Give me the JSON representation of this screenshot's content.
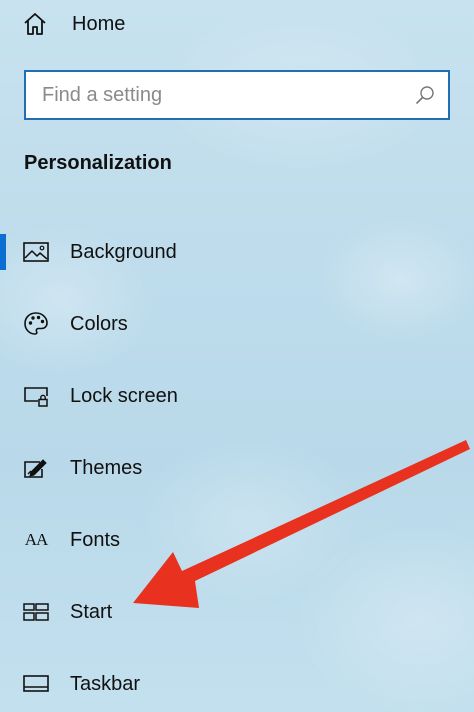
{
  "nav_home": {
    "label": "Home",
    "icon": "home-icon"
  },
  "search": {
    "placeholder": "Find a setting",
    "value": "",
    "icon": "search-icon"
  },
  "section": {
    "title": "Personalization"
  },
  "items": [
    {
      "label": "Background",
      "icon": "background-icon",
      "selected": true
    },
    {
      "label": "Colors",
      "icon": "palette-icon",
      "selected": false
    },
    {
      "label": "Lock screen",
      "icon": "lock-screen-icon",
      "selected": false
    },
    {
      "label": "Themes",
      "icon": "themes-icon",
      "selected": false
    },
    {
      "label": "Fonts",
      "icon": "fonts-icon",
      "selected": false
    },
    {
      "label": "Start",
      "icon": "start-icon",
      "selected": false
    },
    {
      "label": "Taskbar",
      "icon": "taskbar-icon",
      "selected": false
    }
  ],
  "icon_glyphs": {
    "fonts": "AA"
  },
  "colors": {
    "accent": "#0a6fd0",
    "search_border": "#1f6fb2",
    "annotation_arrow": "#e8321f"
  }
}
